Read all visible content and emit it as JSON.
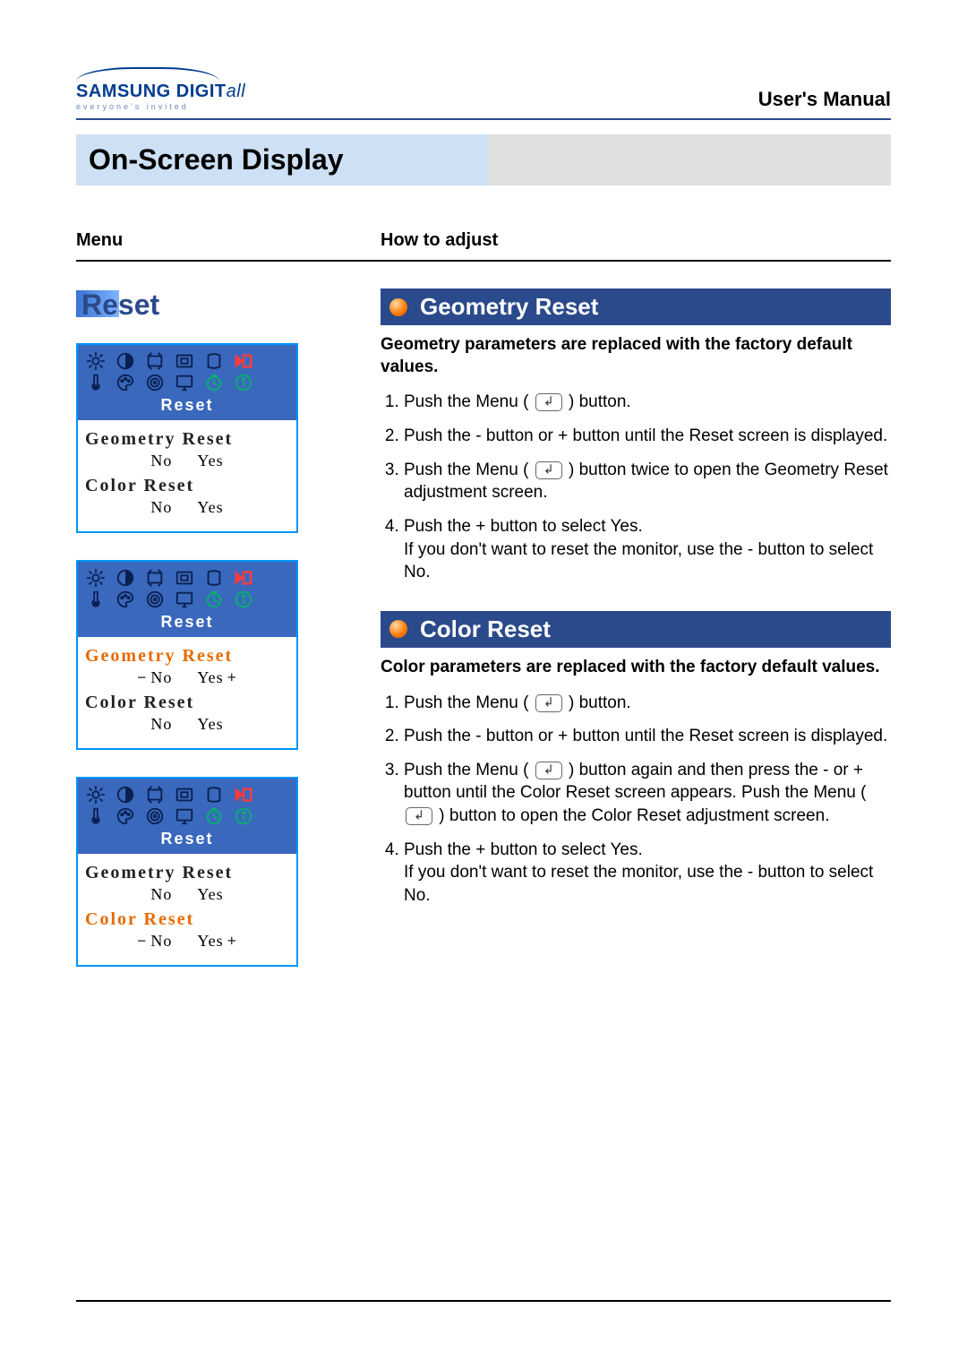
{
  "header": {
    "brand_main": "SAMSUNG DIGIT",
    "brand_suffix": "all",
    "tagline": "everyone's invited",
    "manual_title": "User's Manual"
  },
  "section_title": "On-Screen Display",
  "columns": {
    "menu": "Menu",
    "howto": "How to adjust"
  },
  "reset_heading": "Reset",
  "osd": {
    "reset_label": "Reset",
    "geometry_label": "Geometry Reset",
    "color_label": "Color Reset",
    "no": "No",
    "yes": "Yes",
    "minus": "−",
    "plus": "+"
  },
  "geometry": {
    "title": "Geometry Reset",
    "desc": "Geometry parameters are replaced with the factory default values.",
    "steps": {
      "s1a": "Push the Menu (",
      "s1b": ") button.",
      "s2": "Push the - button or + button until the Reset screen is displayed.",
      "s3a": "Push the Menu (",
      "s3b": ") button twice to open the Geometry Reset adjustment screen.",
      "s4a": "Push the + button to select Yes.",
      "s4b": "If you don't want to reset the monitor, use the - button to select No."
    }
  },
  "color": {
    "title": "Color Reset",
    "desc": "Color parameters are replaced with the factory default values.",
    "steps": {
      "s1a": "Push the Menu (",
      "s1b": ") button.",
      "s2": "Push the - button or + button until the Reset screen is displayed.",
      "s3a": "Push the Menu (",
      "s3b": ") button again and then press  the - or + button until the Color Reset screen appears. Push the Menu (",
      "s3c": ") button to open the Color Reset adjustment screen.",
      "s4a": "Push the + button to select Yes.",
      "s4b": "If you don't want to reset the monitor, use the - button to select No."
    }
  }
}
